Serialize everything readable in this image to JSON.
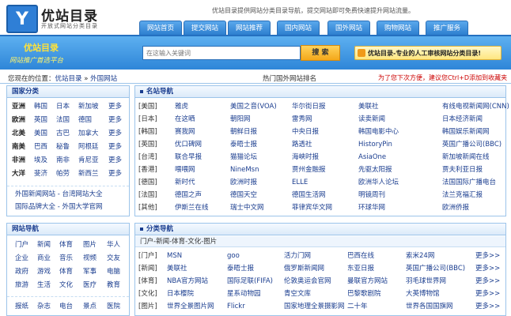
{
  "header": {
    "logo_letter": "Y",
    "logo_name": "优站目录",
    "logo_sub": "开放式网站分类目录",
    "slogan": "优站目录提供网站分类目录导航，提交网站即可免费快速提升网站流量。"
  },
  "nav": {
    "tabs": [
      "网站首页",
      "提交网站",
      "网站推荐",
      "国内网站",
      "国外网站",
      "购物网站",
      "推广服务"
    ]
  },
  "banner": {
    "title": "优站目录",
    "subtitle": "网站推广首选平台",
    "search_placeholder": "在这输入关键词",
    "search_button": "搜 索",
    "promo_text": "优站目录-专业的人工审核网站分类目录!"
  },
  "crumb": {
    "prefix": "您现在的位置：",
    "home": "优站目录",
    "separator": " » ",
    "current": "外国网站",
    "hot": "热门国外网站排名",
    "bookmark_tip": "为了您下次方便，建议您Ctrl+D添加到收藏夹"
  },
  "country_panel": {
    "title": "国家分类",
    "rows": [
      {
        "label": "亚洲",
        "items": [
          "韩国",
          "日本",
          "新加坡"
        ],
        "more": "更多"
      },
      {
        "label": "欧洲",
        "items": [
          "英国",
          "法国",
          "德国"
        ],
        "more": "更多"
      },
      {
        "label": "北美",
        "items": [
          "美国",
          "古巴",
          "加拿大"
        ],
        "more": "更多"
      },
      {
        "label": "南美",
        "items": [
          "巴西",
          "秘鲁",
          "阿根廷"
        ],
        "more": "更多"
      },
      {
        "label": "非洲",
        "items": [
          "埃及",
          "南非",
          "肯尼亚"
        ],
        "more": "更多"
      },
      {
        "label": "大洋",
        "items": [
          "斐济",
          "帕劳",
          "新西兰"
        ],
        "more": "更多"
      }
    ],
    "links": [
      "外国新闻网站 - 台湾网站大全",
      "国际品牌大全 - 外国大学官网"
    ]
  },
  "famous_panel": {
    "title": "名站导航",
    "rows": [
      {
        "label": "[美国]",
        "items": [
          "雅虎",
          "美国之音(VOA)",
          "华尔街日报",
          "美联社",
          "有线电视新闻网(CNN)"
        ]
      },
      {
        "label": "[日本]",
        "items": [
          "在这晒",
          "朝阳网",
          "雷秀网",
          "读卖新闻",
          "日本经济新闻"
        ]
      },
      {
        "label": "[韩国]",
        "items": [
          "赛我网",
          "朝鲜日报",
          "中央日报",
          "韩国电影中心",
          "韩国娱乐新闻网"
        ]
      },
      {
        "label": "[英国]",
        "items": [
          "优口碑网",
          "泰晤士报",
          "路透社",
          "HistoryPin",
          "英国广播公司(BBC)"
        ]
      },
      {
        "label": "[台湾]",
        "items": [
          "联合早报",
          "猫猫论坛",
          "海峡时报",
          "AsiaOne",
          "新加坡新闻在线"
        ]
      },
      {
        "label": "[香港]",
        "items": [
          "喂喂网",
          "NineMsn",
          "贾州金融报",
          "先驱太阳报",
          "贾夫利亚日报"
        ]
      },
      {
        "label": "[德国]",
        "items": [
          "新时代",
          "欧洲时报",
          "ELLE",
          "欧洲华人论坛",
          "法国国际广播电台"
        ]
      },
      {
        "label": "[法国]",
        "items": [
          "德国之声",
          "德国天空",
          "德国生活网",
          "明镜周刊",
          "法兰克福汇报"
        ]
      },
      {
        "label": "[其他]",
        "items": [
          "伊斯兰在线",
          "瑞士中文网",
          "菲律宾华文网",
          "环球华网",
          "欧洲侨报"
        ]
      }
    ]
  },
  "sites_panel": {
    "title": "网站导航",
    "rows": [
      [
        "门户",
        "新闻",
        "体育",
        "图片",
        "华人"
      ],
      [
        "企业",
        "商业",
        "音乐",
        "视频",
        "交友"
      ],
      [
        "政府",
        "游戏",
        "体育",
        "军事",
        "电脑"
      ],
      [
        "旅游",
        "生活",
        "文化",
        "医疗",
        "教育"
      ],
      [
        "报纸",
        "杂志",
        "电台",
        "景点",
        "医院"
      ]
    ]
  },
  "category_panel": {
    "title": "分类导航",
    "subhead": "门户-新闻-体育-文化-图片",
    "rows": [
      {
        "label": "[门户]",
        "items": [
          "MSN",
          "goo",
          "活力门网",
          "巴西在线",
          "索米24网"
        ],
        "more": "更多>>"
      },
      {
        "label": "[新闻]",
        "items": [
          "美联社",
          "泰晤士报",
          "俄罗斯新闻网",
          "东亚日报",
          "英国广播公司(BBC)"
        ],
        "more": "更多>>"
      },
      {
        "label": "[体育]",
        "items": [
          "NBA官方网站",
          "国际足联(FIFA)",
          "伦敦奥运会官网",
          "曼联官方网站",
          "羽毛球世界网"
        ],
        "more": "更多>>"
      },
      {
        "label": "[文化]",
        "items": [
          "日本樱院",
          "星系动物园",
          "青空文库",
          "巴黎歌剧院",
          "大英博物馆"
        ],
        "more": "更多>>"
      },
      {
        "label": "[图片]",
        "items": [
          "世界全景图片网",
          "Flickr",
          "国家地理全景摄影网",
          "二十年",
          "世界各国国旗网"
        ],
        "more": "更多>>"
      }
    ]
  }
}
